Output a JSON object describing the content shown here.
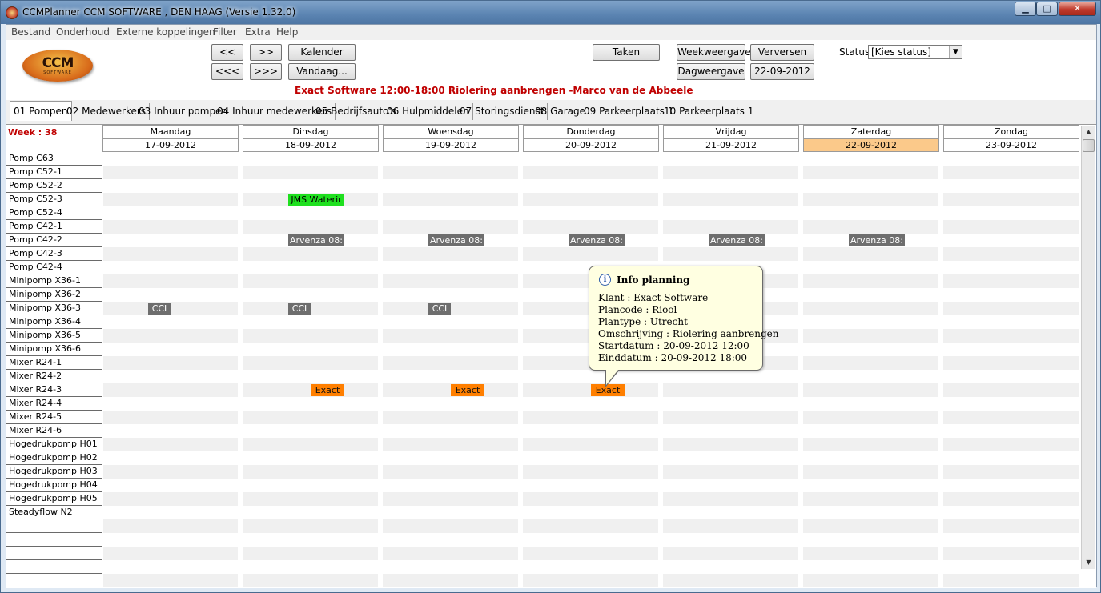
{
  "window": {
    "title": "CCMPlanner CCM SOFTWARE , DEN HAAG (Versie 1.32.0)",
    "min_glyph": "▁",
    "max_glyph": "□",
    "close_glyph": "✕"
  },
  "menu": [
    "Bestand",
    "Onderhoud",
    "Externe koppelingen",
    "Filter",
    "Extra",
    "Help"
  ],
  "logo": {
    "text": "CCM",
    "sub": "SOFTWARE"
  },
  "toolbar": {
    "prev": "<<",
    "next": ">>",
    "prev_far": "<<<",
    "next_far": ">>>",
    "kalender": "Kalender",
    "vandaag": "Vandaag...",
    "taken": "Taken",
    "weekweergave": "Weekweergave",
    "verversen": "Verversen",
    "dagweergave": "Dagweergave",
    "date": "22-09-2012",
    "status_label": "Status",
    "status_value": "[Kies status]",
    "info_line": "Exact Software 12:00-18:00 Riolering aanbrengen  -Marco van de Abbeele"
  },
  "tabs": [
    "01 Pompen",
    "02 Medewerkers",
    "03 Inhuur pompen",
    "04 Inhuur medewerkers",
    "05 Bedrijfsauto's",
    "06 Hulpmiddelen",
    "07 Storingsdienst",
    "08 Garage",
    "09 Parkeerplaats 1",
    "10 Parkeerplaats 1"
  ],
  "week_label": "Week : 38",
  "days": [
    {
      "name": "Maandag",
      "date": "17-09-2012"
    },
    {
      "name": "Dinsdag",
      "date": "18-09-2012"
    },
    {
      "name": "Woensdag",
      "date": "19-09-2012"
    },
    {
      "name": "Donderdag",
      "date": "20-09-2012"
    },
    {
      "name": "Vrijdag",
      "date": "21-09-2012"
    },
    {
      "name": "Zaterdag",
      "date": "22-09-2012"
    },
    {
      "name": "Zondag",
      "date": "23-09-2012"
    }
  ],
  "resources": [
    "Pomp C63",
    "Pomp C52-1",
    "Pomp C52-2",
    "Pomp C52-3",
    "Pomp C52-4",
    "Pomp C42-1",
    "Pomp C42-2",
    "Pomp C42-3",
    "Pomp C42-4",
    "Minipomp X36-1",
    "Minipomp X36-2",
    "Minipomp X36-3",
    "Minipomp X36-4",
    "Minipomp X36-5",
    "Minipomp X36-6",
    "Mixer R24-1",
    "Mixer R24-2",
    "Mixer R24-3",
    "Mixer R24-4",
    "Mixer R24-5",
    "Mixer R24-6",
    "Hogedrukpomp H01",
    "Hogedrukpomp H02",
    "Hogedrukpomp H03",
    "Hogedrukpomp H04",
    "Hogedrukpomp H05",
    "Steadyflow N2"
  ],
  "events": [
    {
      "label": "JMS Waterir",
      "color": "green"
    },
    {
      "label": "Arvenza 08:",
      "color": "gray"
    },
    {
      "label": "Arvenza 08:",
      "color": "gray"
    },
    {
      "label": "Arvenza 08:",
      "color": "gray"
    },
    {
      "label": "Arvenza 08:",
      "color": "gray"
    },
    {
      "label": "Arvenza 08:",
      "color": "gray"
    },
    {
      "label": "CCI",
      "color": "gray"
    },
    {
      "label": "CCI",
      "color": "gray"
    },
    {
      "label": "CCI",
      "color": "gray"
    },
    {
      "label": "Exact",
      "color": "orange"
    },
    {
      "label": "Exact",
      "color": "orange"
    },
    {
      "label": "Exact",
      "color": "orange"
    }
  ],
  "tooltip": {
    "title": "Info planning",
    "klant": "Klant : Exact Software",
    "plancode": "Plancode : Riool",
    "plantype": "Plantype : Utrecht",
    "omschrijving": "Omschrijving : Riolering aanbrengen",
    "start": "Startdatum : 20-09-2012 12:00",
    "eind": "Einddatum : 20-09-2012 18:00"
  },
  "scroll": {
    "up": "▲",
    "down": "▼"
  },
  "colors": {
    "today": "#fbc98a",
    "green": "#1fe01f",
    "gray": "#6e6e6e",
    "orange": "#ff7f00",
    "accent_red": "#c00000"
  }
}
